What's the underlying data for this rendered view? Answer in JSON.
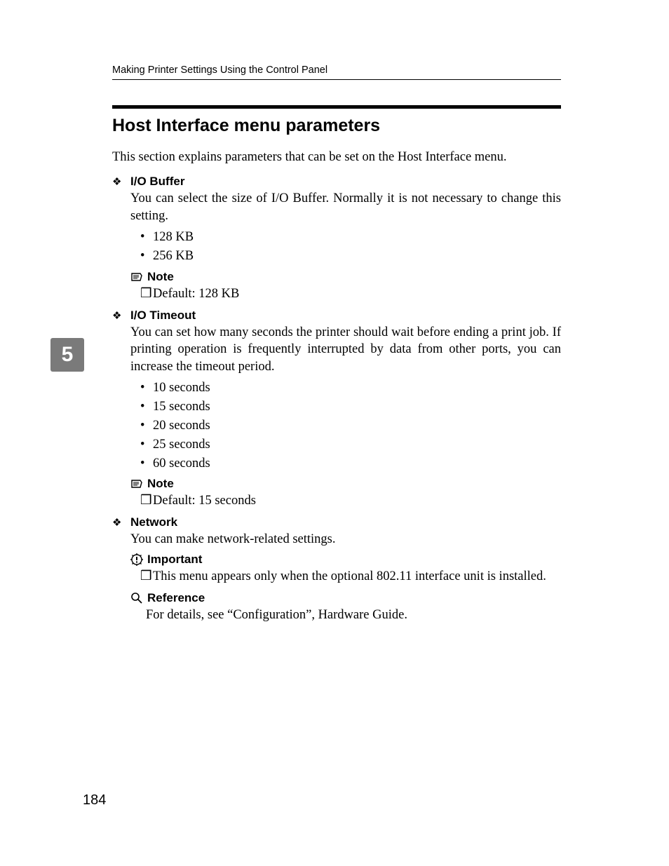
{
  "runningHead": "Making Printer Settings Using the Control Panel",
  "chapterNumber": "5",
  "pageNumber": "184",
  "title": "Host Interface menu parameters",
  "intro": "This section explains parameters that can be set on the Host Interface menu.",
  "params": {
    "ioBuffer": {
      "name": "I/O Buffer",
      "desc": "You can select the size of I/O Buffer. Normally it is not necessary to change this setting.",
      "options": [
        "128 KB",
        "256 KB"
      ],
      "noteLabel": "Note",
      "noteText": "Default: 128 KB"
    },
    "ioTimeout": {
      "name": "I/O Timeout",
      "desc": "You can set how many seconds the printer should wait before ending a print job. If printing operation is frequently interrupted by data from other ports, you can increase the timeout period.",
      "options": [
        "10 seconds",
        "15 seconds",
        "20 seconds",
        "25 seconds",
        "60 seconds"
      ],
      "noteLabel": "Note",
      "noteText": "Default: 15 seconds"
    },
    "network": {
      "name": "Network",
      "desc": "You can make network-related settings.",
      "importantLabel": "Important",
      "importantText": "This menu appears only when the optional 802.11 interface unit is installed.",
      "referenceLabel": "Reference",
      "referenceText": "For details, see “Configuration”, Hardware Guide."
    }
  }
}
